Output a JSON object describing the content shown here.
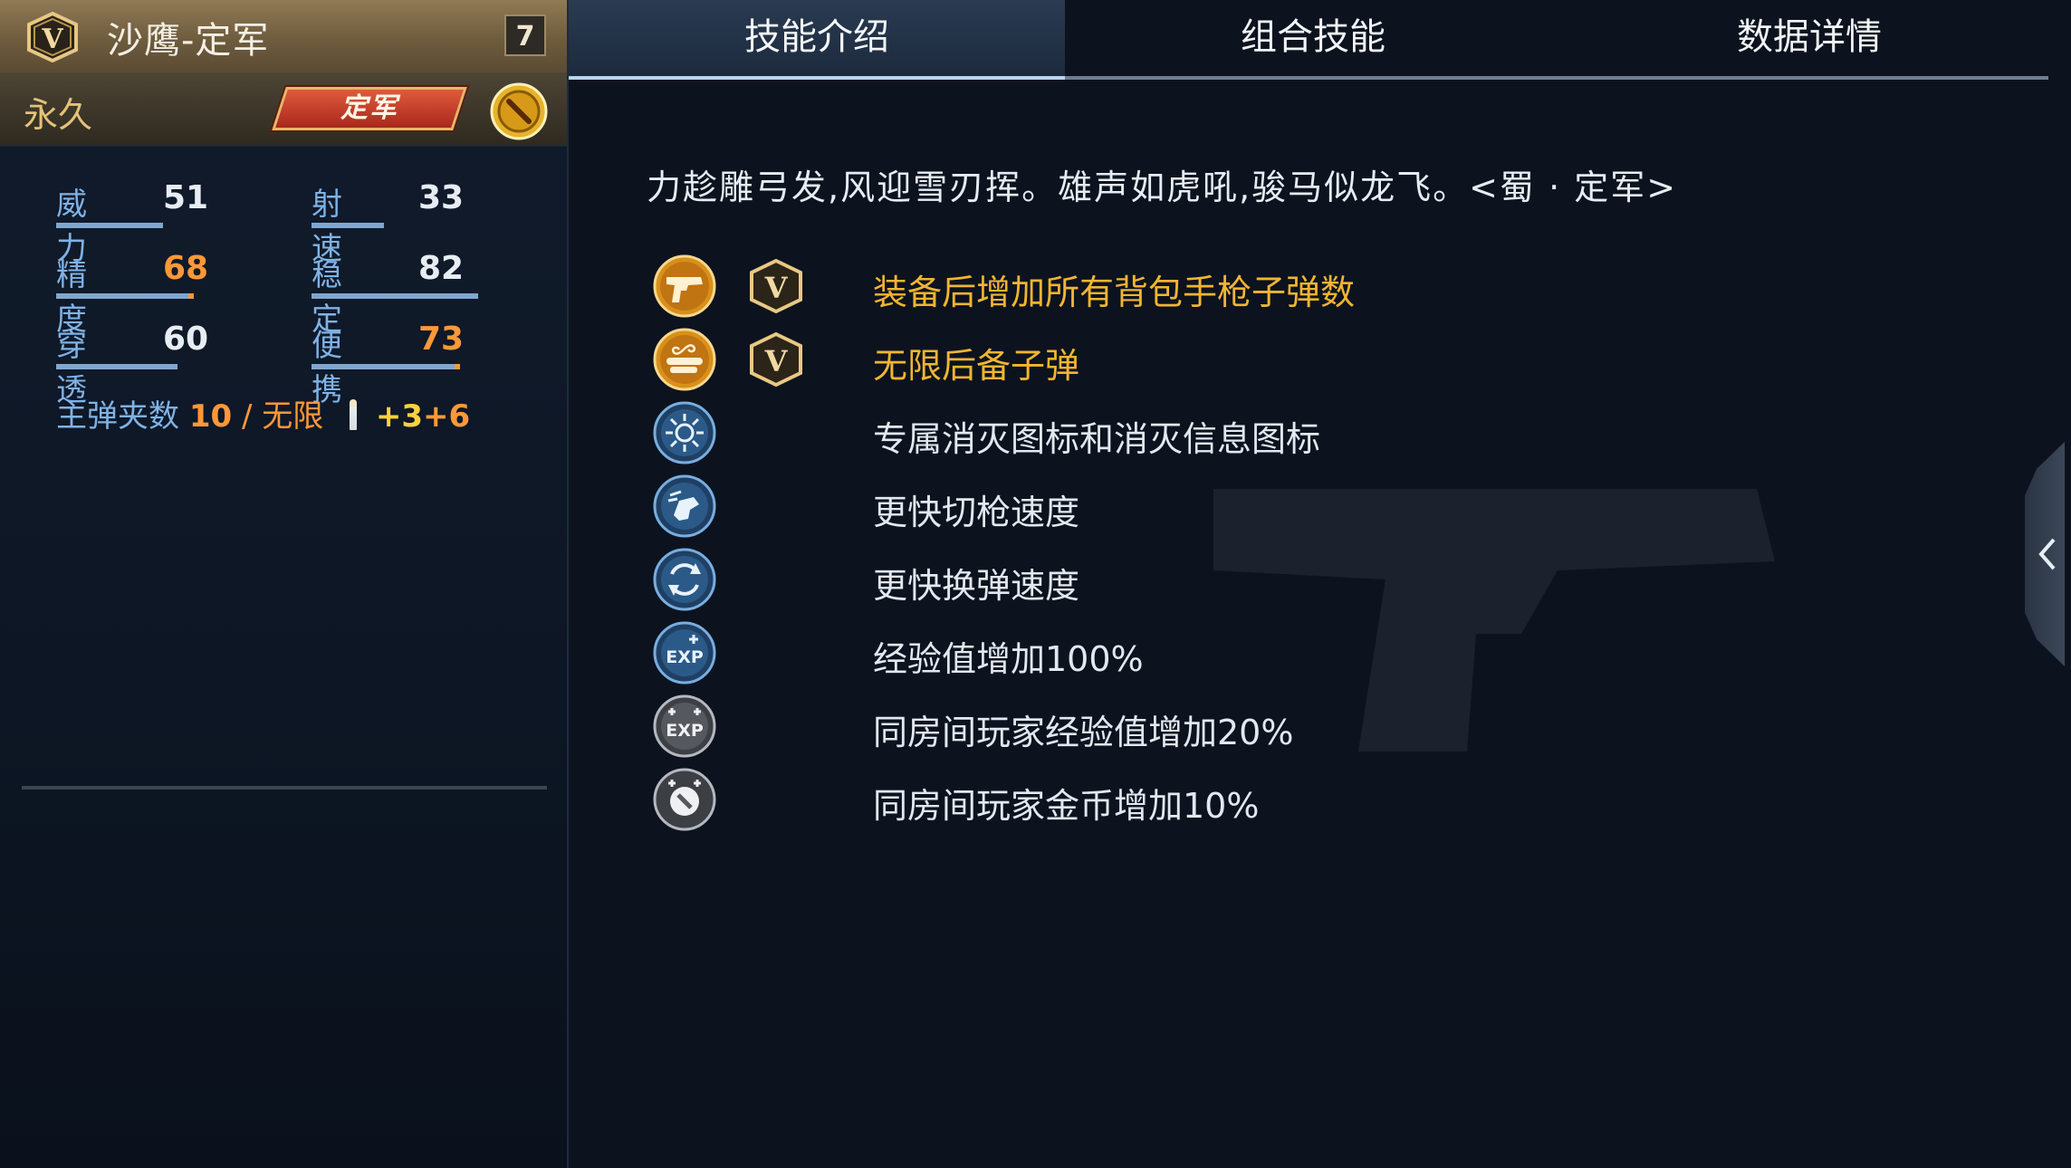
{
  "weapon": {
    "name": "沙鹰-定军",
    "level": "7",
    "duration": "永久",
    "tag": "定军"
  },
  "stats": [
    {
      "label": "威力",
      "value": "51",
      "highlight": false
    },
    {
      "label": "射速",
      "value": "33",
      "highlight": false
    },
    {
      "label": "精度",
      "value": "68",
      "highlight": true
    },
    {
      "label": "稳定",
      "value": "82",
      "highlight": false
    },
    {
      "label": "穿透",
      "value": "60",
      "highlight": false
    },
    {
      "label": "便携",
      "value": "73",
      "highlight": true
    }
  ],
  "ammo": {
    "label": "主弹夹数",
    "clip": "10",
    "sep": "/",
    "reserve": "无限",
    "bonus1": "+3",
    "bonus2": "+6"
  },
  "tabs": [
    "技能介绍",
    "组合技能",
    "数据详情"
  ],
  "active_tab": 0,
  "quote": "力趁雕弓发,风迎雪刃挥。雄声如虎吼,骏马似龙飞。<蜀 · 定军>",
  "skills": [
    {
      "icon": "pistol-icon",
      "special": true,
      "text": "装备后增加所有背包手枪子弹数"
    },
    {
      "icon": "infinite-ammo-icon",
      "special": true,
      "text": "无限后备子弹"
    },
    {
      "icon": "kill-icon",
      "special": false,
      "text": "专属消灭图标和消灭信息图标"
    },
    {
      "icon": "swap-speed-icon",
      "special": false,
      "text": "更快切枪速度"
    },
    {
      "icon": "reload-speed-icon",
      "special": false,
      "text": "更快换弹速度"
    },
    {
      "icon": "exp-icon",
      "special": false,
      "text": "经验值增加100%"
    },
    {
      "icon": "room-exp-icon",
      "special": false,
      "text": "同房间玩家经验值增加20%"
    },
    {
      "icon": "room-coin-icon",
      "special": false,
      "text": "同房间玩家金币增加10%"
    }
  ],
  "colors": {
    "accent_gold": "#f2b531",
    "stat_label": "#7fb2e6",
    "stat_highlight": "#ff9838",
    "background": "#0c131f"
  }
}
